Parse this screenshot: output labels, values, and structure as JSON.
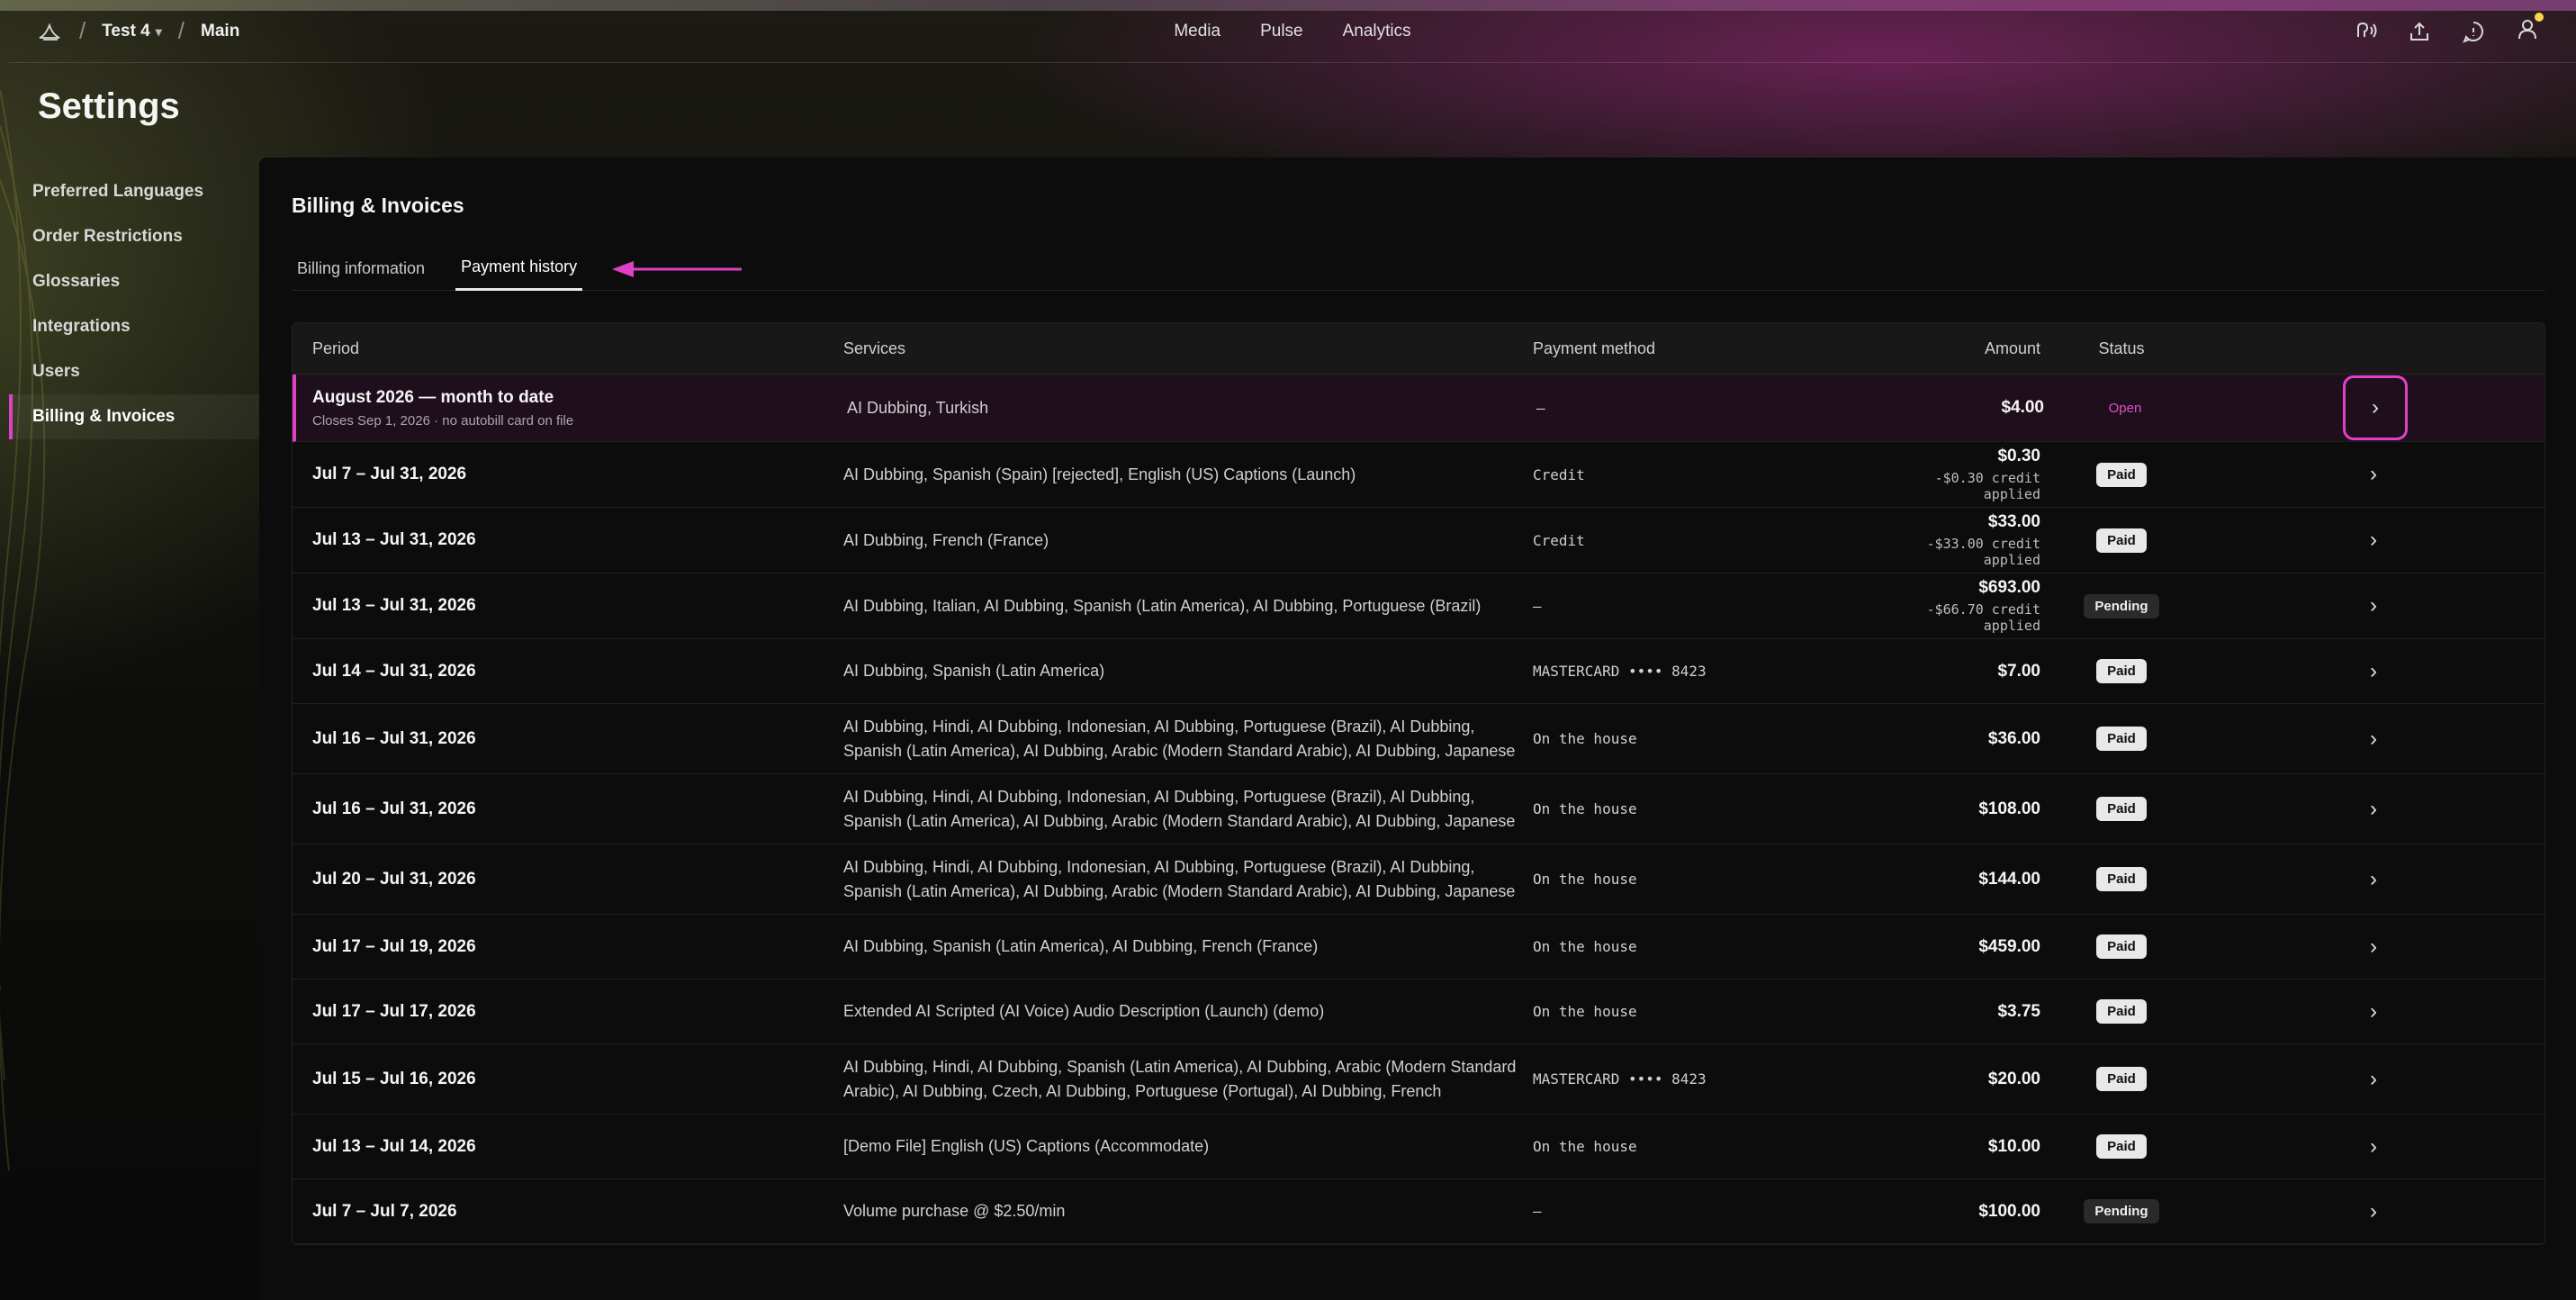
{
  "header": {
    "workspace": "Test 4",
    "project": "Main",
    "nav": [
      "Media",
      "Pulse",
      "Analytics"
    ]
  },
  "page_title": "Settings",
  "sidebar": {
    "items": [
      {
        "label": "Preferred Languages"
      },
      {
        "label": "Order Restrictions"
      },
      {
        "label": "Glossaries"
      },
      {
        "label": "Integrations"
      },
      {
        "label": "Users"
      },
      {
        "label": "Billing & Invoices"
      }
    ]
  },
  "panel": {
    "title": "Billing & Invoices",
    "tabs": [
      {
        "label": "Billing information"
      },
      {
        "label": "Payment history"
      }
    ]
  },
  "table": {
    "columns": {
      "period": "Period",
      "services": "Services",
      "method": "Payment method",
      "amount": "Amount",
      "status": "Status"
    },
    "rows": [
      {
        "period": "August 2026 — month to date",
        "sub": "Closes Sep 1, 2026 · no autobill card on file",
        "services": "AI Dubbing, Turkish",
        "method": "–",
        "amount": "$4.00",
        "credit": "",
        "status": "Open"
      },
      {
        "period": "Jul 7 – Jul 31, 2026",
        "sub": "",
        "services": "AI Dubbing, Spanish (Spain) [rejected], English (US) Captions (Launch)",
        "method": "Credit",
        "amount": "$0.30",
        "credit": "-$0.30 credit applied",
        "status": "Paid"
      },
      {
        "period": "Jul 13 – Jul 31, 2026",
        "sub": "",
        "services": "AI Dubbing, French (France)",
        "method": "Credit",
        "amount": "$33.00",
        "credit": "-$33.00 credit applied",
        "status": "Paid"
      },
      {
        "period": "Jul 13 – Jul 31, 2026",
        "sub": "",
        "services": "AI Dubbing, Italian, AI Dubbing, Spanish (Latin America), AI Dubbing, Portuguese (Brazil)",
        "method": "–",
        "amount": "$693.00",
        "credit": "-$66.70 credit applied",
        "status": "Pending"
      },
      {
        "period": "Jul 14 – Jul 31, 2026",
        "sub": "",
        "services": "AI Dubbing, Spanish (Latin America)",
        "method": "MASTERCARD •••• 8423",
        "amount": "$7.00",
        "credit": "",
        "status": "Paid"
      },
      {
        "period": "Jul 16 – Jul 31, 2026",
        "sub": "",
        "services": "AI Dubbing, Hindi, AI Dubbing, Indonesian, AI Dubbing, Portuguese (Brazil), AI Dubbing, Spanish (Latin America), AI Dubbing, Arabic (Modern Standard Arabic), AI Dubbing, Japanese",
        "method": "On the house",
        "amount": "$36.00",
        "credit": "",
        "status": "Paid"
      },
      {
        "period": "Jul 16 – Jul 31, 2026",
        "sub": "",
        "services": "AI Dubbing, Hindi, AI Dubbing, Indonesian, AI Dubbing, Portuguese (Brazil), AI Dubbing, Spanish (Latin America), AI Dubbing, Arabic (Modern Standard Arabic), AI Dubbing, Japanese",
        "method": "On the house",
        "amount": "$108.00",
        "credit": "",
        "status": "Paid"
      },
      {
        "period": "Jul 20 – Jul 31, 2026",
        "sub": "",
        "services": "AI Dubbing, Hindi, AI Dubbing, Indonesian, AI Dubbing, Portuguese (Brazil), AI Dubbing, Spanish (Latin America), AI Dubbing, Arabic (Modern Standard Arabic), AI Dubbing, Japanese",
        "method": "On the house",
        "amount": "$144.00",
        "credit": "",
        "status": "Paid"
      },
      {
        "period": "Jul 17 – Jul 19, 2026",
        "sub": "",
        "services": "AI Dubbing, Spanish (Latin America), AI Dubbing, French (France)",
        "method": "On the house",
        "amount": "$459.00",
        "credit": "",
        "status": "Paid"
      },
      {
        "period": "Jul 17 – Jul 17, 2026",
        "sub": "",
        "services": "Extended AI Scripted (AI Voice) Audio Description (Launch) (demo)",
        "method": "On the house",
        "amount": "$3.75",
        "credit": "",
        "status": "Paid"
      },
      {
        "period": "Jul 15 – Jul 16, 2026",
        "sub": "",
        "services": "AI Dubbing, Hindi, AI Dubbing, Spanish (Latin America), AI Dubbing, Arabic (Modern Standard Arabic), AI Dubbing, Czech, AI Dubbing, Portuguese (Portugal), AI Dubbing, French",
        "method": "MASTERCARD •••• 8423",
        "amount": "$20.00",
        "credit": "",
        "status": "Paid"
      },
      {
        "period": "Jul 13 – Jul 14, 2026",
        "sub": "",
        "services": "[Demo File] English (US) Captions (Accommodate)",
        "method": "On the house",
        "amount": "$10.00",
        "credit": "",
        "status": "Paid"
      },
      {
        "period": "Jul 7 – Jul 7, 2026",
        "sub": "",
        "services": "Volume purchase @ $2.50/min",
        "method": "–",
        "amount": "$100.00",
        "credit": "",
        "status": "Pending"
      }
    ]
  },
  "icons": {
    "voice": "voice-assistant-icon",
    "upload": "upload-icon",
    "chat": "chat-icon",
    "user": "user-icon",
    "row_go": "chevron-right-icon"
  },
  "colors": {
    "accent": "#e040c8",
    "paid_badge": "#e8e8e8",
    "pending_badge": "#2a2a2a"
  }
}
